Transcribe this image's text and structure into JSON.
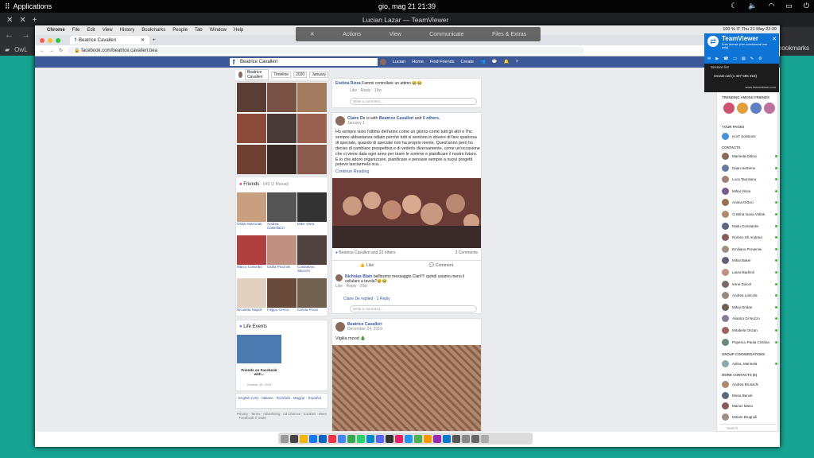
{
  "system": {
    "apps_label": "Applications",
    "clock": "gio, mag 21    21:39"
  },
  "outer": {
    "tab_title": "Lucian Lazar — TeamViewer",
    "bookmark": "OwL",
    "right_bookmarks": "bookmarks"
  },
  "mac": {
    "menu": [
      "Chrome",
      "File",
      "Edit",
      "View",
      "History",
      "Bookmarks",
      "People",
      "Tab",
      "Window",
      "Help"
    ],
    "tray_right": "100 %  IT   Thu 21 May  22:39"
  },
  "chrome": {
    "tab": "Beatrice Cavalleri",
    "url": "facebook.com/beatrice.cavalleri.bea"
  },
  "teamviewer": {
    "toolbar": [
      "Actions",
      "View",
      "Communicate",
      "Files & Extras"
    ],
    "brand": "TeamViewer",
    "brand_sub": "Free license (non-commercial use only)",
    "session_title": "Session list",
    "session_item": "reneat-owl (1 407 586 318)",
    "session_footer": "www.teamviewer.com"
  },
  "fb": {
    "search_value": "Beatrice Cavalleri",
    "nav": [
      "Lucian",
      "Home",
      "Find Friends",
      "Create"
    ],
    "timeline": {
      "name": "Beatrice Cavalleri",
      "label": "Timeline",
      "year": "2020",
      "month": "January"
    },
    "friends": {
      "title": "Friends",
      "count": "· 649 (2 Mutual)",
      "list": [
        "Oskar Marcinak",
        "Andrea Castellazzi",
        "Mike Viera",
        "Marco Colombo",
        "Giulia Piccinini",
        "Costantino Skecchi",
        "Nicoletta Napoli",
        "Filippo Grenzi",
        "Carola Pironi"
      ]
    },
    "life": {
      "title": "Life Events",
      "event": "Friends on Facebook with...",
      "date": "October 16, 2019"
    },
    "langs": "English (US) · Italiano · Română · Magyar · Español",
    "footer": "Privacy · Terms · Advertising · Ad Choices · Cookies · More · Facebook © 2020",
    "feed_top": {
      "name": "Evelina Rizza",
      "text": "Fammi controllare un attimo 😂😂",
      "meta": "Like · Reply · 19w",
      "comment_placeholder": "Write a comment..."
    },
    "post2": {
      "author": "Claire De",
      "with": " is with ",
      "author2": "Beatrice Cavalleri",
      "and": " and ",
      "others": "5 others.",
      "date": "January 1 · ",
      "text": "Ho sempre visto l'ultimo dell'anno come un giorno come tutti gli altri e l'ho sempre abbastanza odiato perché tutti si sentono in dovere di fare qualcosa di speciale, quando di speciale non ha proprio niente. Quest'anno però ho deciso di cambiare prospettiva e di vederlo diversamente, come un'occasione che ci viene data ogni anno per tirare le somme e pianificare il nostro futuro. E io che adoro organizzare, pianificare e pensare sempre a nuovi progetti potevo lasciarmela sca...",
      "more": "Continue Reading",
      "reactions": "Beatrice Cavalleri and 22 others",
      "comments": "3 Comments",
      "like": "Like",
      "comment": "Comment",
      "c_name": "Nicholas Blain",
      "c_text": "bellissimo messaggio Clari!!!! quindi usiamo meno il cellulare a tavola?😄😂",
      "c_meta": "Like · Reply · 20w",
      "reply": "Claire De replied · 1 Reply",
      "comment_placeholder": "Write a comment..."
    },
    "post3": {
      "author": "Beatrice Cavalleri",
      "date": "December 24, 2019 · ",
      "text": "Vigilia mood 🎄"
    }
  },
  "rightbar": {
    "trending": "TRENDING AMONG FRIENDS",
    "pages": "YOUR PAGES",
    "page1": "ecoT Solutions",
    "contacts": "CONTACTS",
    "list": [
      "Marinela Dittoci",
      "Daan Hertems",
      "Luca Taurisano",
      "Mihai Vinsa",
      "Ariana Dittoci",
      "Cristina Ioana Vollati",
      "Radu Constantin",
      "Romeo Sh Andreia",
      "Emiliano Provenini",
      "Mihai Baker",
      "Laura Badiroli",
      "Irene Doicel",
      "Andrea Laricola",
      "Mihai Dridan",
      "Aliantro Di Nuzzo",
      "Mirabela Orizan",
      "Popescu Paula Cristina"
    ],
    "groups": "GROUP CONVERSATIONS",
    "group1": "Adina, Marinela",
    "more": "MORE CONTACTS (6)",
    "more_list": [
      "Andrea Brusachi",
      "Elena Benoti",
      "Marius Manu",
      "Miriam Brugnoli"
    ],
    "search": "Search"
  }
}
